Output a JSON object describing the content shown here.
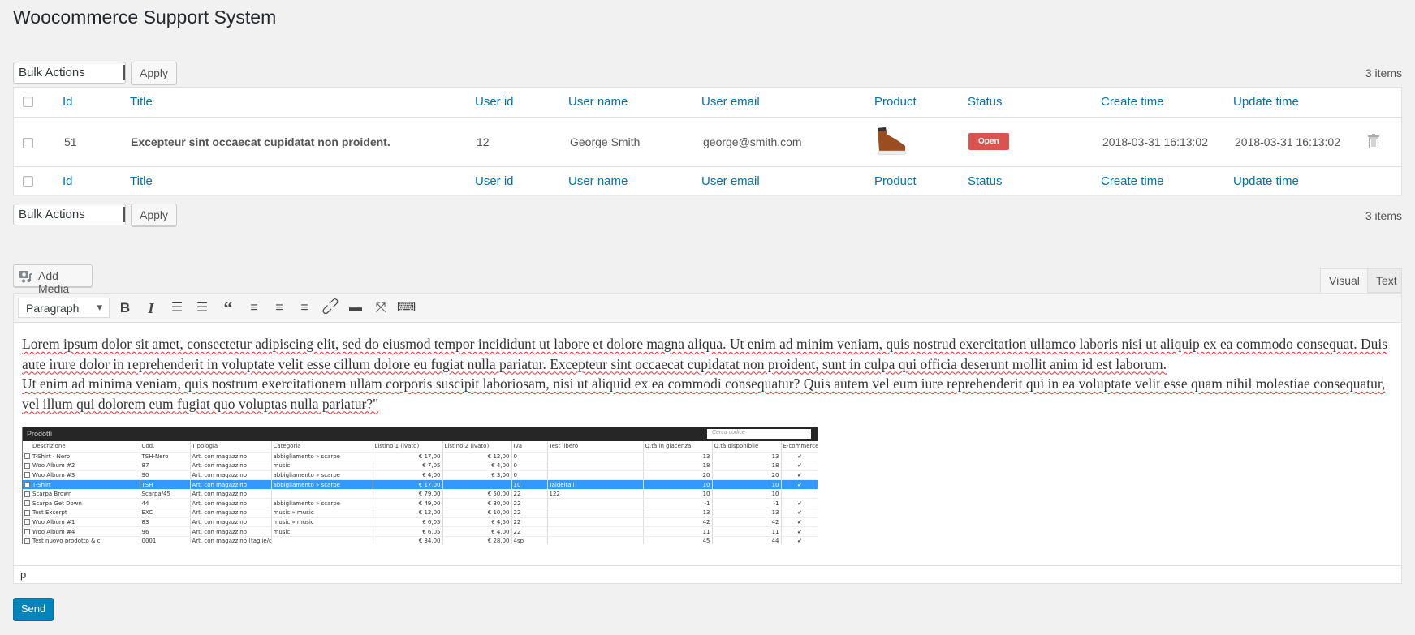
{
  "page_title": "Woocommerce Support System",
  "bulk": {
    "select_value": "Bulk Actions",
    "apply": "Apply",
    "count": "3 items"
  },
  "columns": {
    "id": "Id",
    "title": "Title",
    "user_id": "User id",
    "user_name": "User name",
    "user_email": "User email",
    "product": "Product",
    "status": "Status",
    "create_time": "Create time",
    "update_time": "Update time"
  },
  "rows": [
    {
      "id": "51",
      "title": "Excepteur sint occaecat cupidatat non proident.",
      "user_id": "12",
      "user_name": "George Smith",
      "user_email": "george@smith.com",
      "status": "Open",
      "create_time": "2018-03-31 16:13:02",
      "update_time": "2018-03-31 16:13:02"
    }
  ],
  "colors": {
    "link": "#0073aa",
    "status_open": "#d9534f",
    "primary_button": "#0085ba"
  },
  "editor": {
    "add_media": "Add Media",
    "tab_visual": "Visual",
    "tab_text": "Text",
    "format": "Paragraph",
    "toolbar_icons": [
      "bold-icon",
      "italic-icon",
      "bullet-list-icon",
      "numbered-list-icon",
      "blockquote-icon",
      "align-left-icon",
      "align-center-icon",
      "align-right-icon",
      "link-icon",
      "read-more-icon",
      "fullscreen-icon",
      "toolbar-toggle-icon"
    ],
    "paragraph1": "Lorem ipsum dolor sit amet, consectetur adipiscing elit, sed do eiusmod tempor incididunt ut labore et dolore magna aliqua. Ut enim ad minim veniam, quis nostrud exercitation ullamco laboris nisi ut aliquip ex ea commodo consequat. Duis aute irure dolor in reprehenderit in voluptate velit esse cillum dolore eu fugiat nulla pariatur. Excepteur sint occaecat cupidatat non proident, sunt in culpa qui officia deserunt mollit anim id est laborum.",
    "paragraph2": "Ut enim ad minima veniam, quis nostrum exercitationem ullam corporis suscipit laboriosam, nisi ut aliquid ex ea commodi consequatur? Quis autem vel eum iure reprehenderit qui in ea voluptate velit esse quam nihil molestiae consequatur, vel illum qui dolorem eum fugiat quo voluptas nulla pariatur?\"",
    "path": "p",
    "image": {
      "title": "Prodotti",
      "search_placeholder": "Cerca codice",
      "headers": [
        "Descrizione",
        "Cod.",
        "Tipologia",
        "Categoria",
        "Listino 1 (ivato)",
        "Listino 2 (ivato)",
        "Iva",
        "Test libero",
        "Q.tà in giacenza",
        "Q.tà disponibile",
        "E-commerce"
      ],
      "rows": [
        [
          "T-Shirt - Nero",
          "TSH-Nero",
          "Art. con magazzino",
          "abbigliamento » scarpe",
          "€ 17,00",
          "€ 12,00",
          "0",
          "",
          "13",
          "13",
          "✔"
        ],
        [
          "Woo Album #2",
          "87",
          "Art. con magazzino",
          "music",
          "€ 7,05",
          "€ 4,00",
          "0",
          "",
          "18",
          "18",
          "✔"
        ],
        [
          "Woo Album #3",
          "90",
          "Art. con magazzino",
          "abbigliamento » scarpe",
          "€ 4,00",
          "€ 3,00",
          "0",
          "",
          "20",
          "20",
          "✔"
        ],
        [
          "T-Shirt",
          "TSH",
          "Art. con magazzino",
          "abbigliamento » scarpe",
          "€ 17,00",
          "",
          "10",
          "Taldeitali",
          "10",
          "10",
          "✔"
        ],
        [
          "Scarpa Brown",
          "Scarpa/45",
          "Art. con magazzino",
          "",
          "€ 79,00",
          "€ 50,00",
          "22",
          "122",
          "10",
          "10",
          ""
        ],
        [
          "Scarpa Get Down",
          "44",
          "Art. con magazzino",
          "abbigliamento » scarpe",
          "€ 49,00",
          "€ 30,00",
          "22",
          "",
          "-1",
          "-1",
          "✔"
        ],
        [
          "Test Excerpt",
          "EXC",
          "Art. con magazzino",
          "music » music",
          "€ 12,00",
          "€ 10,00",
          "22",
          "",
          "13",
          "13",
          "✔"
        ],
        [
          "Woo Album #1",
          "83",
          "Art. con magazzino",
          "music » music",
          "€ 6,05",
          "€ 4,50",
          "22",
          "",
          "42",
          "42",
          "✔"
        ],
        [
          "Woo Album #4",
          "96",
          "Art. con magazzino",
          "music",
          "€ 6,05",
          "€ 4,00",
          "22",
          "",
          "11",
          "11",
          "✔"
        ],
        [
          "Test nuovo prodotto & c.",
          "0001",
          "Art. con magazzino (taglie/co",
          "",
          "€ 34,00",
          "€ 28,00",
          "4sp",
          "",
          "45",
          "44",
          "✔"
        ]
      ],
      "highlighted_row": 3
    }
  },
  "send": "Send"
}
